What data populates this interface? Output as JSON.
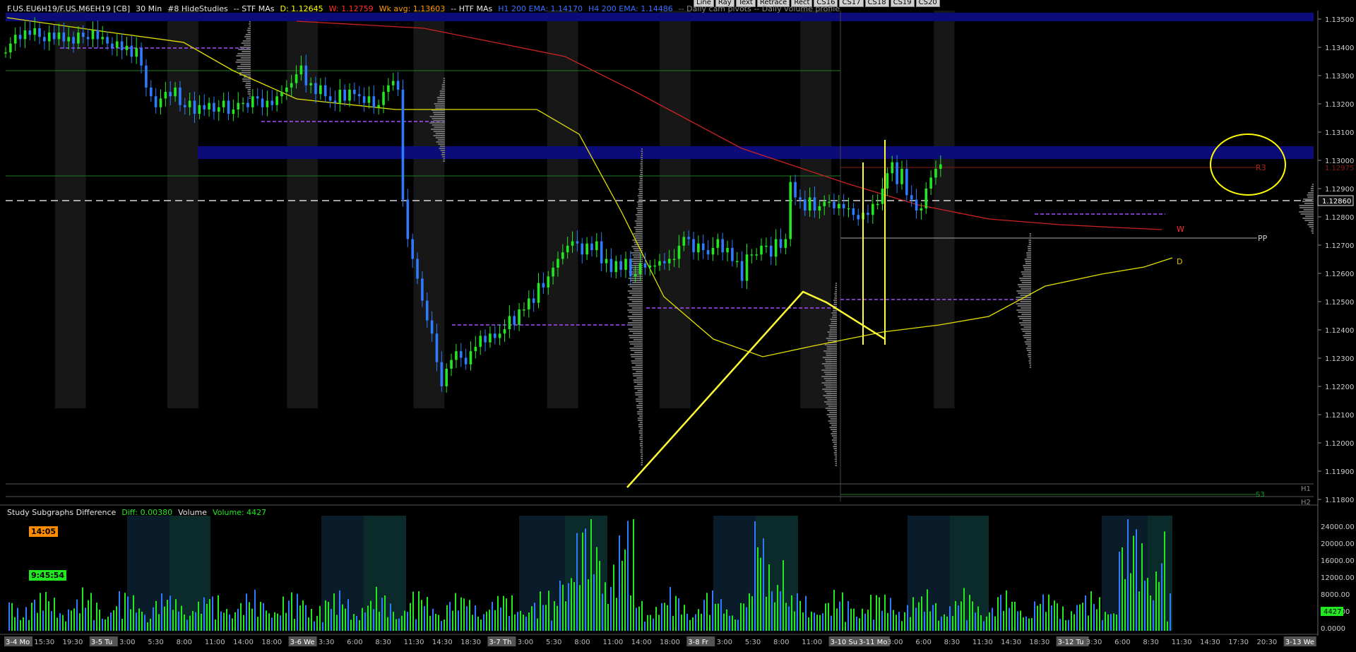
{
  "header": {
    "symbol": "F.US.EU6H19/F.US.M6EH19 [CB]",
    "timeframe": "30 Min",
    "studies": "#8 HideStudies",
    "stf": "-- STF MAs",
    "daily": "D: 1.12645",
    "weekly": "W: 1.12759",
    "wk_avg": "Wk avg: 1.13603",
    "htf": "-- HTF MAs",
    "h1_ema": "H1 200 EMA: 1.14170",
    "h4_ema": "H4 200 EMA: 1.14486",
    "rest": "-- Daily cam pivots -- Daily volume profile",
    "colors": {
      "daily": "#ffff00",
      "weekly": "#ff3030",
      "wk_avg": "#ff9900",
      "ema": "#3b6cff"
    }
  },
  "toolbar": [
    "Line",
    "Ray",
    "Text",
    "Retrace",
    "Rect",
    "CS16",
    "CS17",
    "CS18",
    "CS19",
    "CS20"
  ],
  "price_axis": {
    "labels": [
      "1.13500",
      "1.13400",
      "1.13300",
      "1.13200",
      "1.13100",
      "1.13000",
      "1.12900",
      "1.12800",
      "1.12700",
      "1.12600",
      "1.12500",
      "1.12400",
      "1.12300",
      "1.12200",
      "1.12100",
      "1.12000",
      "1.11900",
      "1.11800"
    ],
    "current_price": "1.12860",
    "r3_price": "1.12975"
  },
  "time_axis": {
    "labels": [
      "3-4 Mo",
      "15:30",
      "19:30",
      "3-5 Tu",
      "3:00",
      "5:30",
      "8:00",
      "11:00",
      "14:00",
      "18:00",
      "3-6 We",
      "3:30",
      "6:00",
      "8:30",
      "11:30",
      "14:30",
      "18:30",
      "3-7 Th",
      "3:00",
      "5:30",
      "8:00",
      "11:00",
      "14:00",
      "18:00",
      "3-8 Fr",
      "3:00",
      "5:30",
      "8:00",
      "11:00",
      "3-10 Su",
      "3-11 Mo",
      "3:00",
      "6:00",
      "8:30",
      "11:30",
      "14:30",
      "18:30",
      "3-12 Tu",
      "3:30",
      "6:00",
      "8:30",
      "11:30",
      "14:30",
      "17:30",
      "20:30",
      "3-13 We"
    ]
  },
  "pivot_labels": {
    "r3": "R3",
    "w": "W",
    "pp": "PP",
    "d": "D",
    "s3": "S3",
    "h1": "H1",
    "h2": "H2"
  },
  "subgraph": {
    "title": "Study Subgraphs Difference",
    "diff": "Diff: 0.00380",
    "volume_label": "Volume",
    "volume_value": "Volume: 4427",
    "axis": [
      "24000.00",
      "20000.00",
      "16000.00",
      "12000.00",
      "8000.00",
      "4000.00",
      "0.0000"
    ],
    "current_volume": "4427"
  },
  "clock": {
    "bar_time": "14:05",
    "countdown": "9:45:54"
  },
  "chart_data": {
    "type": "line",
    "title": "F.US.EU6H19/F.US.M6EH19 [CB] 30 Min",
    "xlabel": "",
    "ylabel": "",
    "ylim": [
      1.1175,
      1.1356
    ],
    "x": [
      0,
      5,
      10,
      15,
      20,
      25,
      30,
      35,
      40,
      45,
      50,
      55,
      60,
      65,
      70,
      75,
      80,
      85,
      90,
      95,
      100,
      105,
      110,
      115,
      120,
      125,
      130,
      135,
      140,
      145,
      150,
      155,
      160,
      165,
      170,
      175,
      180,
      185,
      190,
      195,
      200,
      205,
      210,
      215,
      220,
      225,
      230,
      235,
      240,
      245,
      250,
      255,
      260,
      265,
      270,
      275,
      280,
      285,
      290,
      295,
      300,
      305,
      310,
      315,
      320,
      325,
      330,
      335,
      340,
      345,
      350,
      355,
      360,
      365,
      370,
      375,
      380,
      385,
      390,
      395,
      400,
      405,
      410,
      415,
      420,
      425,
      430,
      435,
      440,
      445,
      450,
      455,
      460,
      465,
      470,
      475,
      480,
      485,
      490,
      495,
      500,
      505,
      510,
      515,
      520,
      525,
      530,
      535,
      540,
      545,
      550,
      555,
      560,
      565,
      570,
      575,
      580,
      585,
      590,
      595,
      600,
      605,
      610,
      615,
      620,
      625,
      630,
      635,
      640,
      645,
      650,
      655,
      660,
      665,
      670,
      675,
      680,
      685,
      690,
      695,
      700,
      705,
      710,
      715,
      720,
      725,
      730,
      735,
      740,
      745,
      750,
      755,
      760,
      765,
      770,
      775,
      780,
      785,
      790,
      795,
      800,
      805,
      810,
      815,
      820,
      825,
      830,
      835,
      840,
      845,
      850,
      855,
      860,
      865,
      870,
      875,
      880,
      885,
      890,
      895,
      900,
      905,
      910,
      915,
      920,
      925,
      930,
      935,
      940,
      945,
      950,
      955,
      960,
      965,
      970,
      975,
      980,
      985,
      990,
      995,
      1000,
      1005,
      1010,
      1015,
      1020,
      1025,
      1030,
      1035,
      1040,
      1045,
      1050,
      1055,
      1060,
      1065,
      1070,
      1075,
      1080,
      1085,
      1090,
      1095,
      1100,
      1105,
      1110,
      1115,
      1120,
      1125,
      1130,
      1135,
      1140,
      1145,
      1150,
      1155,
      1160,
      1165,
      1170,
      1175,
      1180,
      1185,
      1190,
      1195,
      1200,
      1205,
      1210,
      1215,
      1220,
      1225,
      1230,
      1235,
      1240,
      1245,
      1250,
      1255,
      1260,
      1265,
      1270,
      1275,
      1280,
      1285,
      1290,
      1295,
      1300,
      1305,
      1310,
      1315,
      1320,
      1325,
      1330,
      1335,
      1340,
      1345,
      1350
    ],
    "series": [
      {
        "values": [
          1.1337,
          1.1341,
          1.1345,
          1.1343,
          1.1347,
          1.1345,
          1.1348,
          1.1344,
          1.1342,
          1.1346,
          1.1343,
          1.1346,
          1.1342,
          1.1344,
          1.1341,
          1.1346,
          1.1344,
          1.1343,
          1.1347,
          1.1343,
          1.1344,
          1.1341,
          1.1339,
          1.1342,
          1.1338,
          1.134,
          1.1335,
          1.1339,
          1.1331,
          1.1321,
          1.1317,
          1.1312,
          1.1316,
          1.1319,
          1.1317,
          1.1321,
          1.1313,
          1.1312,
          1.1315,
          1.1309,
          1.1313,
          1.1311,
          1.1314,
          1.131,
          1.1312,
          1.1315,
          1.1309,
          1.1311,
          1.1314,
          1.1314,
          1.1312,
          1.1317,
          1.1316,
          1.1312,
          1.1315,
          1.1313,
          1.1317,
          1.1319,
          1.1321,
          1.1323,
          1.1327,
          1.1331,
          1.1322,
          1.1323,
          1.1318,
          1.1322,
          1.1317,
          1.1315,
          1.1314,
          1.132,
          1.1315,
          1.132,
          1.1318,
          1.1317,
          1.1314,
          1.1317,
          1.1312,
          1.1313,
          1.1319,
          1.1322,
          1.1324,
          1.132,
          1.127,
          1.1252,
          1.1243,
          1.1234,
          1.1224,
          1.1215,
          1.1209,
          1.1196,
          1.1185,
          1.1193,
          1.1197,
          1.1201,
          1.1198,
          1.1195,
          1.1201,
          1.1203,
          1.1208,
          1.1205,
          1.1209,
          1.1207,
          1.1209,
          1.1211,
          1.1217,
          1.1213,
          1.122,
          1.122,
          1.1225,
          1.1223,
          1.1232,
          1.123,
          1.1235,
          1.1239,
          1.1243,
          1.1246,
          1.1249,
          1.1251,
          1.125,
          1.1245,
          1.125,
          1.1247,
          1.1251,
          1.1241,
          1.1243,
          1.1237,
          1.1242,
          1.1238,
          1.1243,
          1.1235,
          1.1236,
          1.1241,
          1.1239,
          1.124,
          1.124,
          1.1242,
          1.1241,
          1.1243,
          1.1243,
          1.1249,
          1.1253,
          1.1252,
          1.1246,
          1.125,
          1.1247,
          1.1245,
          1.1248,
          1.1252,
          1.1246,
          1.1248,
          1.1242,
          1.1242,
          1.1233,
          1.1245,
          1.1245,
          1.1245,
          1.1249,
          1.1249,
          1.1244,
          1.1252,
          1.1248,
          1.1252,
          1.1278,
          1.1271,
          1.127,
          1.1265,
          1.1271,
          1.1265,
          1.1267,
          1.1269,
          1.1269,
          1.1266,
          1.1268,
          1.1266,
          1.1266,
          1.1263,
          1.1261,
          1.1264,
          1.1263,
          1.1268,
          1.1268,
          1.1275,
          1.1282,
          1.1287,
          1.1277,
          1.1284,
          1.1272,
          1.127,
          1.1265,
          1.1266,
          1.1275,
          1.128,
          1.1284,
          1.1286
        ],
        "colors": {
          "up": "#22e822",
          "down": "#2f7bff"
        }
      }
    ]
  }
}
